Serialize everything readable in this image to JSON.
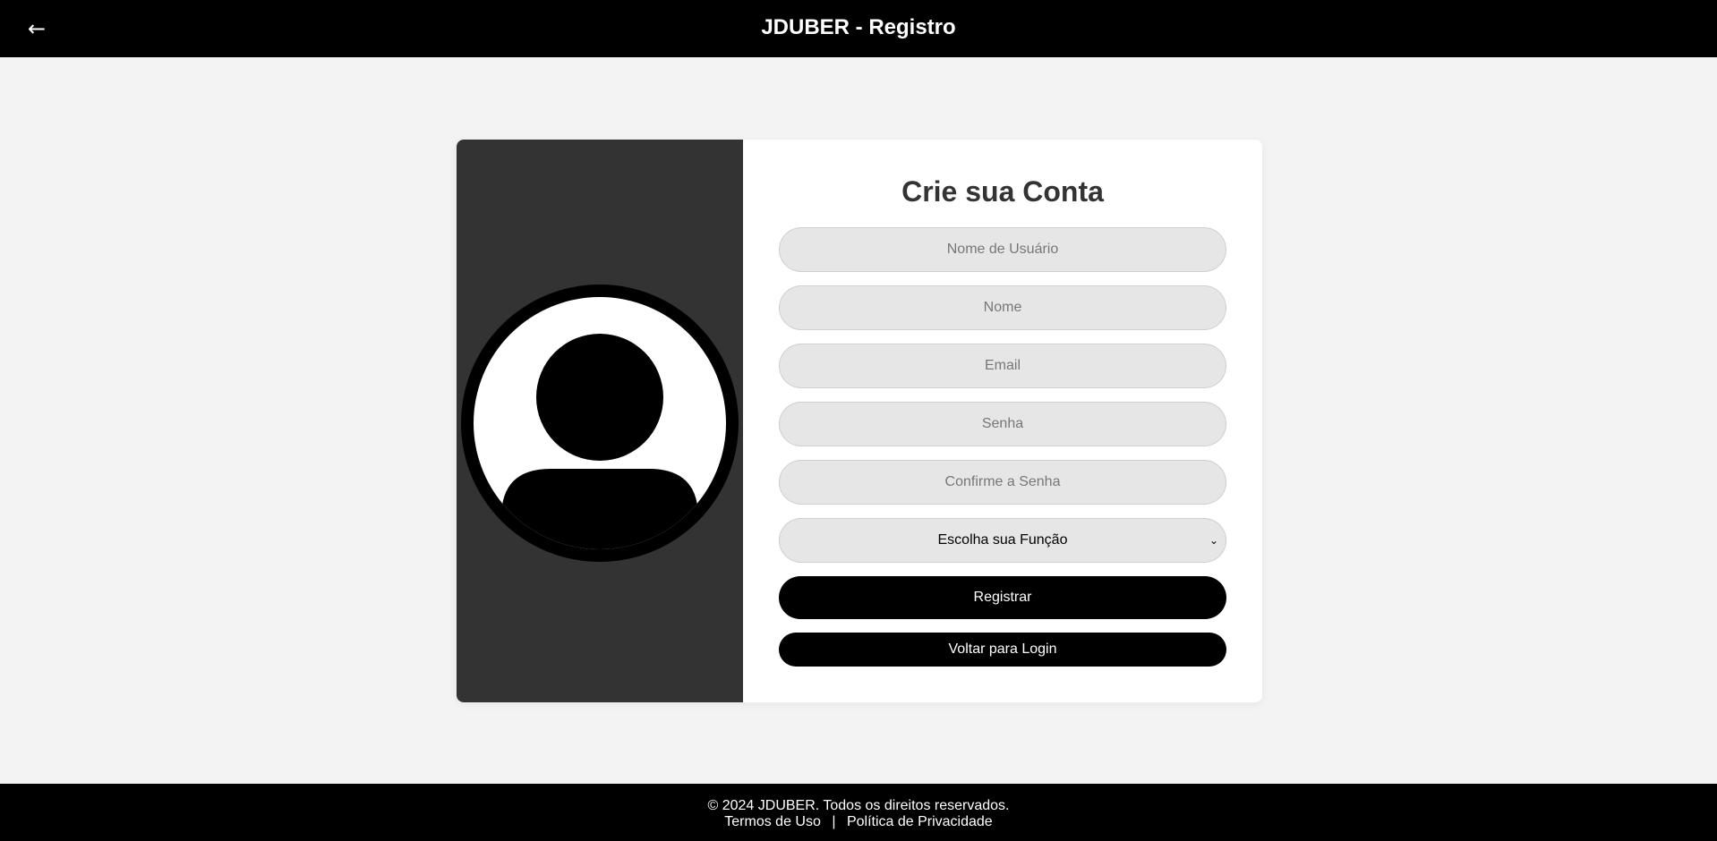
{
  "header": {
    "back_icon": "←",
    "title": "JDUBER - Registro"
  },
  "form": {
    "title": "Crie sua Conta",
    "fields": {
      "username_placeholder": "Nome de Usuário",
      "name_placeholder": "Nome",
      "email_placeholder": "Email",
      "password_placeholder": "Senha",
      "confirm_password_placeholder": "Confirme a Senha"
    },
    "role_select": {
      "selected": "Escolha sua Função"
    },
    "register_label": "Registrar",
    "back_to_login_label": "Voltar para Login"
  },
  "avatar": {
    "icon": "user-avatar-icon"
  },
  "footer": {
    "copyright": "© 2024 JDUBER. Todos os direitos reservados.",
    "terms_label": "Termos de Uso",
    "separator": "|",
    "privacy_label": "Política de Privacidade"
  },
  "colors": {
    "header_bg": "#000000",
    "page_bg": "#f3f3f3",
    "left_panel_bg": "#333333",
    "input_bg": "#e6e6e6",
    "button_bg": "#000000"
  }
}
